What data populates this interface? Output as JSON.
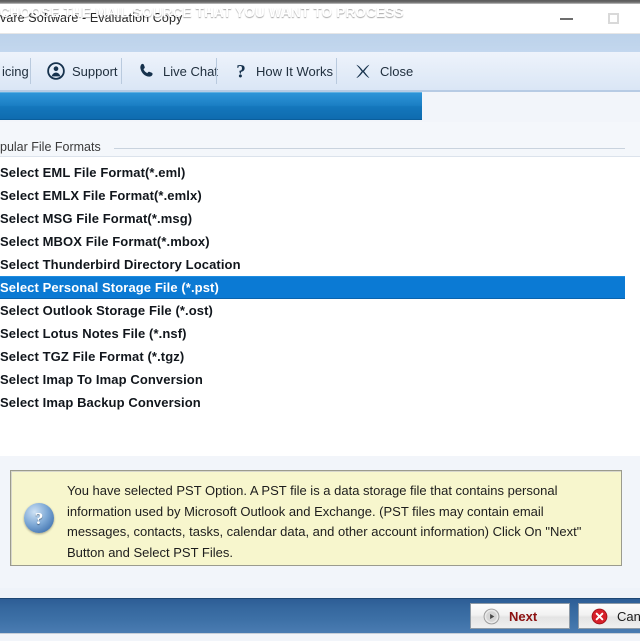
{
  "window": {
    "title": "vare Software - Evaluation Copy",
    "minimize_label": "–",
    "maximize_label": ""
  },
  "toolbar": {
    "items": [
      {
        "label": "icing",
        "icon": "pricing-tag-icon"
      },
      {
        "label": "Support",
        "icon": "support-person-icon"
      },
      {
        "label": "Live Chat",
        "icon": "phone-icon"
      },
      {
        "label": "How It Works",
        "icon": "question-mark-icon"
      },
      {
        "label": "Close",
        "icon": "x-cross-icon"
      }
    ]
  },
  "banner": {
    "text": "CHOOSE THE MAIL SOURCE THAT YOU WANT TO PROCESS",
    "color": "#1477bc"
  },
  "list": {
    "group_label": "pular File Formats",
    "selected_index": 5,
    "selection_color": "#0b7ad4",
    "items": [
      {
        "label": "Select EML File Format(*.eml)"
      },
      {
        "label": "Select EMLX File Format(*.emlx)"
      },
      {
        "label": "Select MSG File Format(*.msg)"
      },
      {
        "label": "Select MBOX File Format(*.mbox)"
      },
      {
        "label": "Select Thunderbird Directory Location"
      },
      {
        "label": "Select Personal Storage File (*.pst)"
      },
      {
        "label": "Select Outlook Storage File (*.ost)"
      },
      {
        "label": "Select Lotus Notes File (*.nsf)"
      },
      {
        "label": "Select TGZ File Format (*.tgz)"
      },
      {
        "label": "Select Imap To Imap Conversion"
      },
      {
        "label": "Select Imap Backup Conversion"
      }
    ]
  },
  "info": {
    "icon": "question-mark-circle-icon",
    "icon_glyph": "?",
    "text": "You have selected PST Option. A PST file is a data storage file that contains personal information used by Microsoft Outlook and Exchange. (PST files may contain email messages, contacts, tasks, calendar data, and other account information) Click On \"Next\" Button and Select PST Files.",
    "background": "#f7f6cd"
  },
  "footer": {
    "next_label": "Next",
    "cancel_label": "Cancel",
    "next_icon": "play-circle-icon",
    "cancel_icon": "cancel-cross-circle-icon",
    "background": "#3d70a6"
  }
}
